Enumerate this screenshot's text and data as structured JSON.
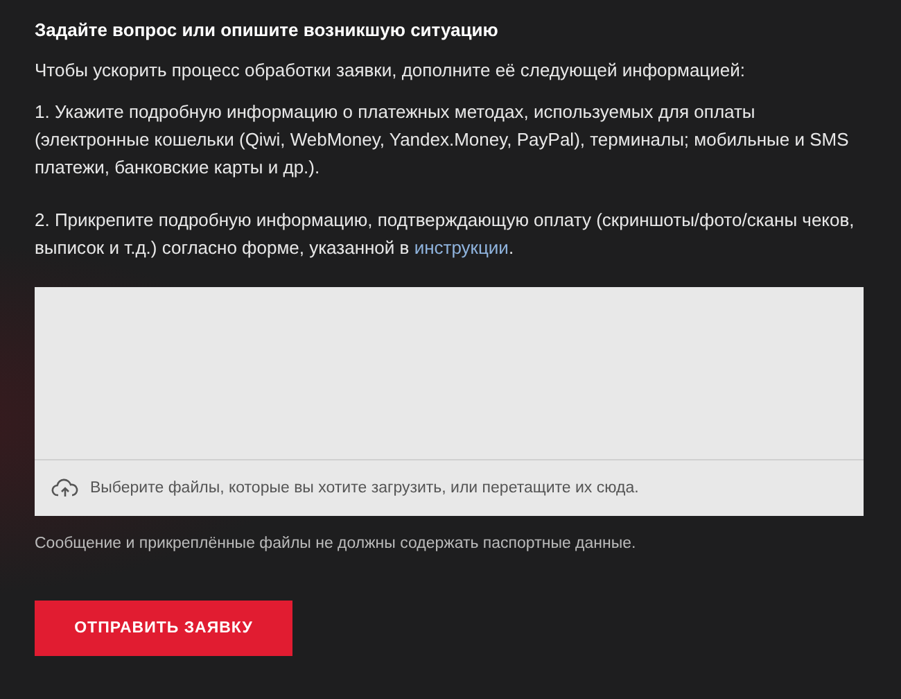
{
  "heading": "Задайте вопрос или опишите возникшую ситуацию",
  "intro": "Чтобы ускорить процесс обработки заявки, дополните её следующей информацией:",
  "step_1": "1. Укажите подробную информацию о платежных методах, используемых для оплаты (электронные кошельки (Qiwi, WebMoney, Yandex.Money, PayPal), терминалы; мобильные и SMS платежи, банковские карты и др.).",
  "step_2": {
    "text": "2. Прикрепите подробную информацию, подтверждающую оплату (скриншоты/фото/сканы чеков, выписок и т.д.) согласно форме, указанной в",
    "link": "инструкции",
    "after": "."
  },
  "upload": {
    "hint": "Выберите файлы, которые вы хотите загрузить, или перетащите их сюда."
  },
  "note": "Сообщение и прикреплённые файлы не должны содержать паспортные данные.",
  "submit": "ОТПРАВИТЬ ЗАЯВКУ"
}
